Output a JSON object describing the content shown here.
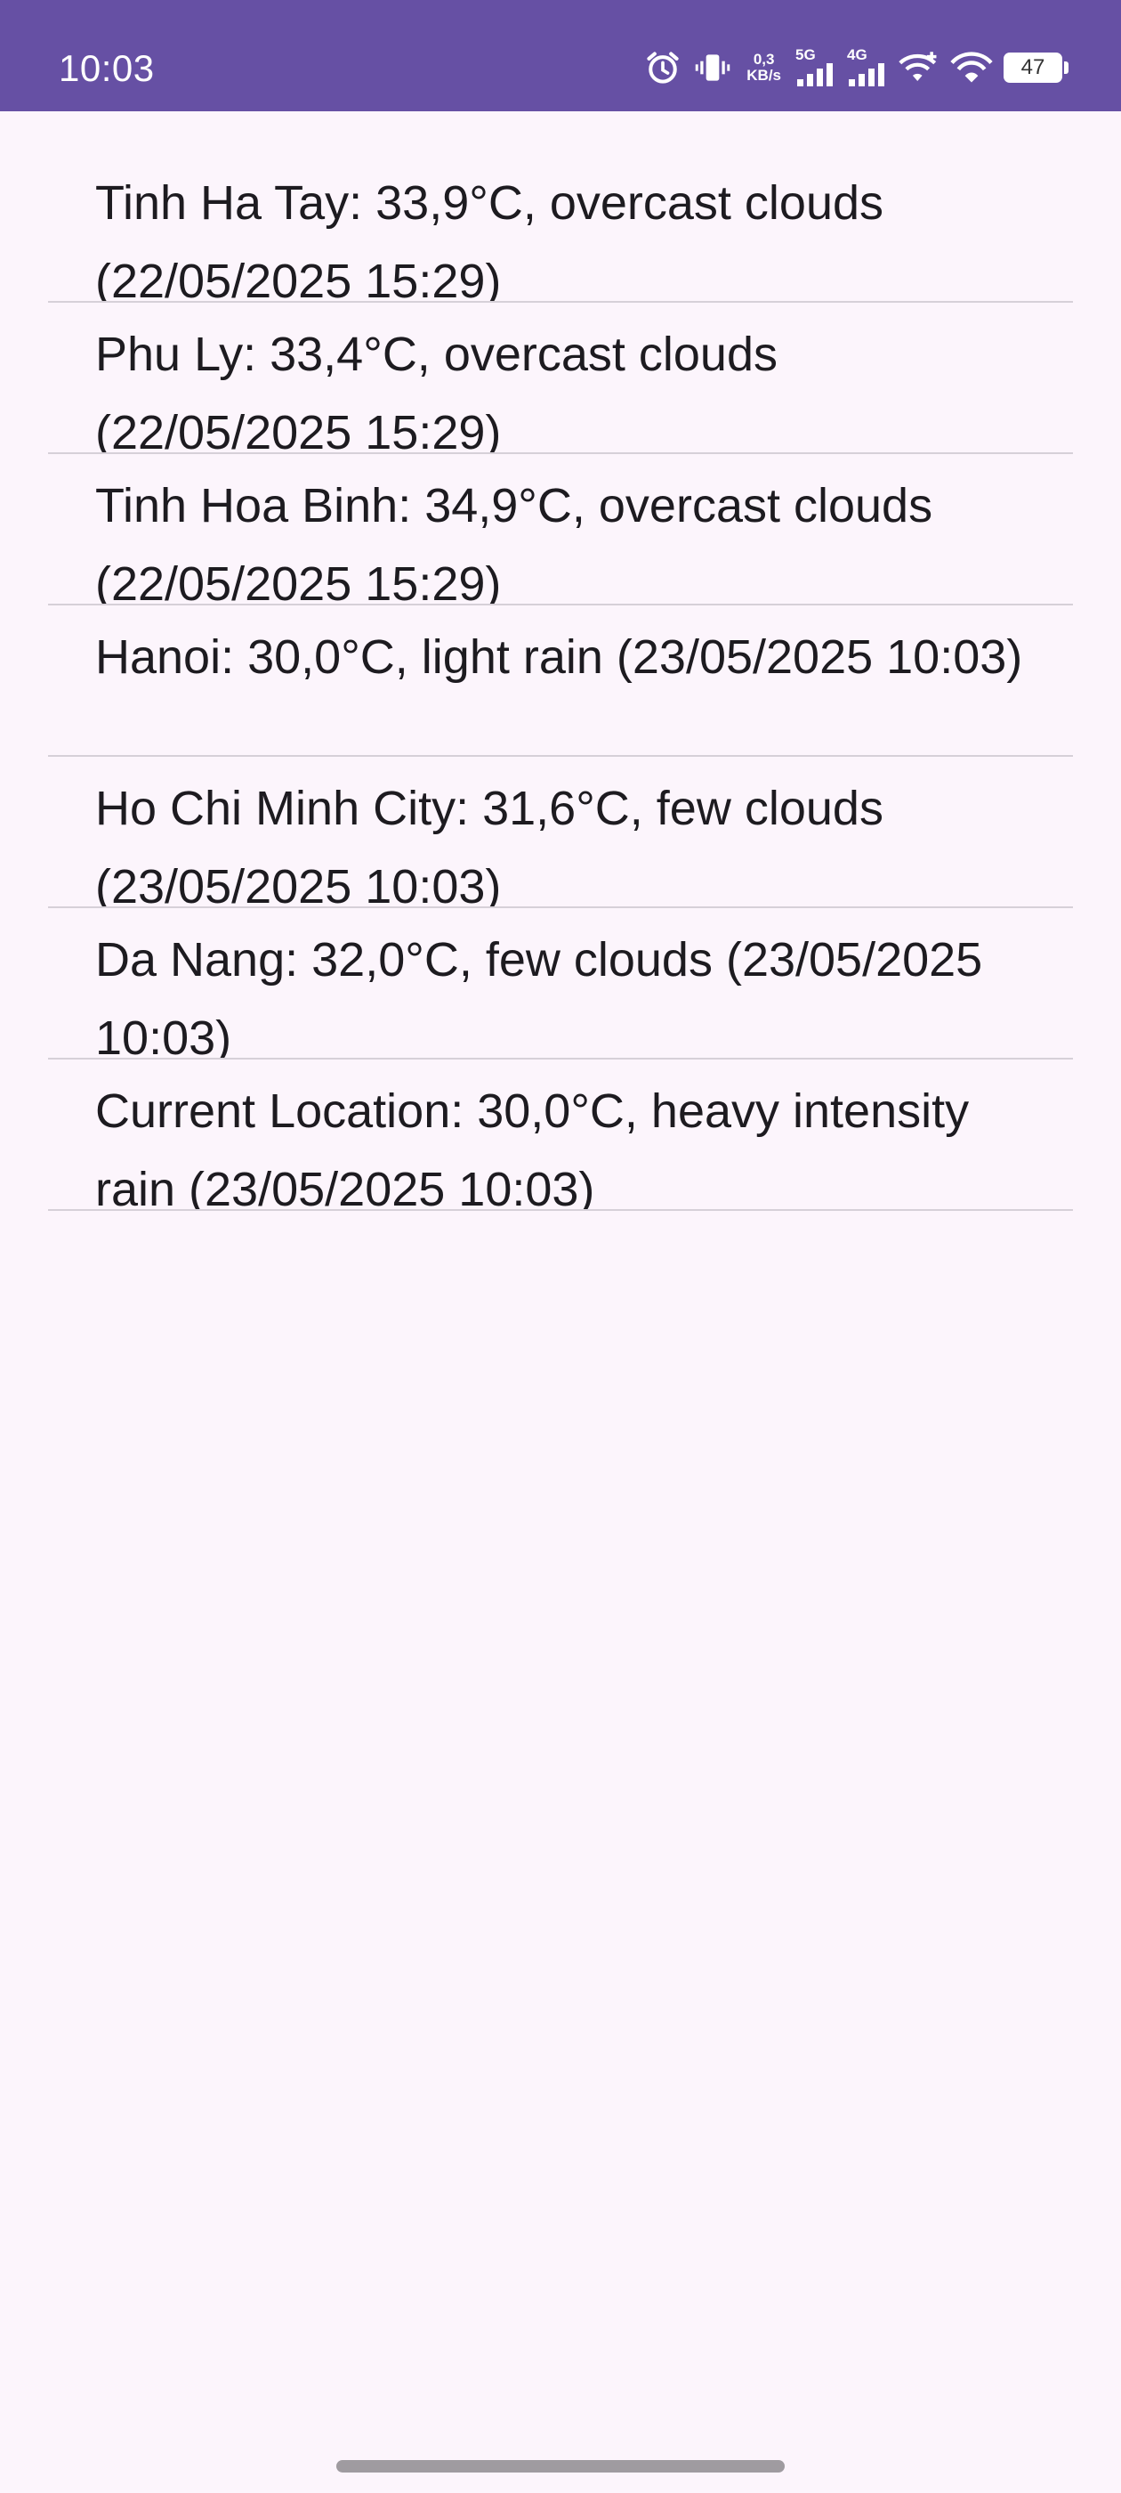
{
  "status_bar": {
    "time": "10:03",
    "net_speed_value": "0,3",
    "net_speed_unit": "KB/s",
    "signal_1_label": "5G",
    "signal_2_label": "4G",
    "battery_level": "47",
    "icons": [
      "alarm-icon",
      "vibrate-icon",
      "signal-5g-icon",
      "signal-4g-icon",
      "wifi-plus-icon",
      "wifi-icon",
      "battery-icon"
    ],
    "colors": {
      "background": "#6650a4",
      "foreground": "#ffffff"
    }
  },
  "weather_list": {
    "items": [
      {
        "text": "Tinh Ha Tay: 33,9°C, overcast clouds (22/05/2025 15:29)"
      },
      {
        "text": "Phu Ly: 33,4°C, overcast clouds (22/05/2025 15:29)"
      },
      {
        "text": "Tinh Hoa Binh: 34,9°C, overcast clouds (22/05/2025 15:29)"
      },
      {
        "text": "Hanoi: 30,0°C, light rain (23/05/2025 10:03)"
      },
      {
        "text": "Ho Chi Minh City: 31,6°C, few clouds (23/05/2025 10:03)"
      },
      {
        "text": "Da Nang: 32,0°C, few clouds (23/05/2025 10:03)"
      },
      {
        "text": "Current Location: 30,0°C, heavy intensity rain (23/05/2025 10:03)"
      }
    ]
  },
  "colors": {
    "page_background": "#fcf5fc",
    "text": "#1d1b20",
    "divider": "#d6d0d8"
  }
}
